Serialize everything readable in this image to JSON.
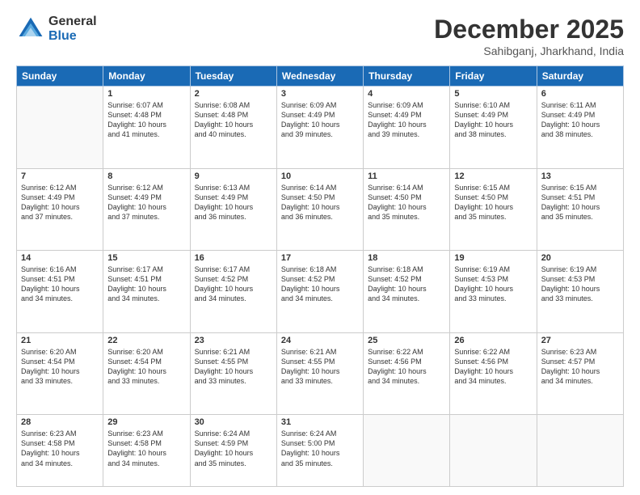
{
  "logo": {
    "general": "General",
    "blue": "Blue"
  },
  "header": {
    "month": "December 2025",
    "location": "Sahibganj, Jharkhand, India"
  },
  "weekdays": [
    "Sunday",
    "Monday",
    "Tuesday",
    "Wednesday",
    "Thursday",
    "Friday",
    "Saturday"
  ],
  "weeks": [
    [
      {
        "day": "",
        "info": ""
      },
      {
        "day": "1",
        "info": "Sunrise: 6:07 AM\nSunset: 4:48 PM\nDaylight: 10 hours\nand 41 minutes."
      },
      {
        "day": "2",
        "info": "Sunrise: 6:08 AM\nSunset: 4:48 PM\nDaylight: 10 hours\nand 40 minutes."
      },
      {
        "day": "3",
        "info": "Sunrise: 6:09 AM\nSunset: 4:49 PM\nDaylight: 10 hours\nand 39 minutes."
      },
      {
        "day": "4",
        "info": "Sunrise: 6:09 AM\nSunset: 4:49 PM\nDaylight: 10 hours\nand 39 minutes."
      },
      {
        "day": "5",
        "info": "Sunrise: 6:10 AM\nSunset: 4:49 PM\nDaylight: 10 hours\nand 38 minutes."
      },
      {
        "day": "6",
        "info": "Sunrise: 6:11 AM\nSunset: 4:49 PM\nDaylight: 10 hours\nand 38 minutes."
      }
    ],
    [
      {
        "day": "7",
        "info": "Sunrise: 6:12 AM\nSunset: 4:49 PM\nDaylight: 10 hours\nand 37 minutes."
      },
      {
        "day": "8",
        "info": "Sunrise: 6:12 AM\nSunset: 4:49 PM\nDaylight: 10 hours\nand 37 minutes."
      },
      {
        "day": "9",
        "info": "Sunrise: 6:13 AM\nSunset: 4:49 PM\nDaylight: 10 hours\nand 36 minutes."
      },
      {
        "day": "10",
        "info": "Sunrise: 6:14 AM\nSunset: 4:50 PM\nDaylight: 10 hours\nand 36 minutes."
      },
      {
        "day": "11",
        "info": "Sunrise: 6:14 AM\nSunset: 4:50 PM\nDaylight: 10 hours\nand 35 minutes."
      },
      {
        "day": "12",
        "info": "Sunrise: 6:15 AM\nSunset: 4:50 PM\nDaylight: 10 hours\nand 35 minutes."
      },
      {
        "day": "13",
        "info": "Sunrise: 6:15 AM\nSunset: 4:51 PM\nDaylight: 10 hours\nand 35 minutes."
      }
    ],
    [
      {
        "day": "14",
        "info": "Sunrise: 6:16 AM\nSunset: 4:51 PM\nDaylight: 10 hours\nand 34 minutes."
      },
      {
        "day": "15",
        "info": "Sunrise: 6:17 AM\nSunset: 4:51 PM\nDaylight: 10 hours\nand 34 minutes."
      },
      {
        "day": "16",
        "info": "Sunrise: 6:17 AM\nSunset: 4:52 PM\nDaylight: 10 hours\nand 34 minutes."
      },
      {
        "day": "17",
        "info": "Sunrise: 6:18 AM\nSunset: 4:52 PM\nDaylight: 10 hours\nand 34 minutes."
      },
      {
        "day": "18",
        "info": "Sunrise: 6:18 AM\nSunset: 4:52 PM\nDaylight: 10 hours\nand 34 minutes."
      },
      {
        "day": "19",
        "info": "Sunrise: 6:19 AM\nSunset: 4:53 PM\nDaylight: 10 hours\nand 33 minutes."
      },
      {
        "day": "20",
        "info": "Sunrise: 6:19 AM\nSunset: 4:53 PM\nDaylight: 10 hours\nand 33 minutes."
      }
    ],
    [
      {
        "day": "21",
        "info": "Sunrise: 6:20 AM\nSunset: 4:54 PM\nDaylight: 10 hours\nand 33 minutes."
      },
      {
        "day": "22",
        "info": "Sunrise: 6:20 AM\nSunset: 4:54 PM\nDaylight: 10 hours\nand 33 minutes."
      },
      {
        "day": "23",
        "info": "Sunrise: 6:21 AM\nSunset: 4:55 PM\nDaylight: 10 hours\nand 33 minutes."
      },
      {
        "day": "24",
        "info": "Sunrise: 6:21 AM\nSunset: 4:55 PM\nDaylight: 10 hours\nand 33 minutes."
      },
      {
        "day": "25",
        "info": "Sunrise: 6:22 AM\nSunset: 4:56 PM\nDaylight: 10 hours\nand 34 minutes."
      },
      {
        "day": "26",
        "info": "Sunrise: 6:22 AM\nSunset: 4:56 PM\nDaylight: 10 hours\nand 34 minutes."
      },
      {
        "day": "27",
        "info": "Sunrise: 6:23 AM\nSunset: 4:57 PM\nDaylight: 10 hours\nand 34 minutes."
      }
    ],
    [
      {
        "day": "28",
        "info": "Sunrise: 6:23 AM\nSunset: 4:58 PM\nDaylight: 10 hours\nand 34 minutes."
      },
      {
        "day": "29",
        "info": "Sunrise: 6:23 AM\nSunset: 4:58 PM\nDaylight: 10 hours\nand 34 minutes."
      },
      {
        "day": "30",
        "info": "Sunrise: 6:24 AM\nSunset: 4:59 PM\nDaylight: 10 hours\nand 35 minutes."
      },
      {
        "day": "31",
        "info": "Sunrise: 6:24 AM\nSunset: 5:00 PM\nDaylight: 10 hours\nand 35 minutes."
      },
      {
        "day": "",
        "info": ""
      },
      {
        "day": "",
        "info": ""
      },
      {
        "day": "",
        "info": ""
      }
    ]
  ]
}
